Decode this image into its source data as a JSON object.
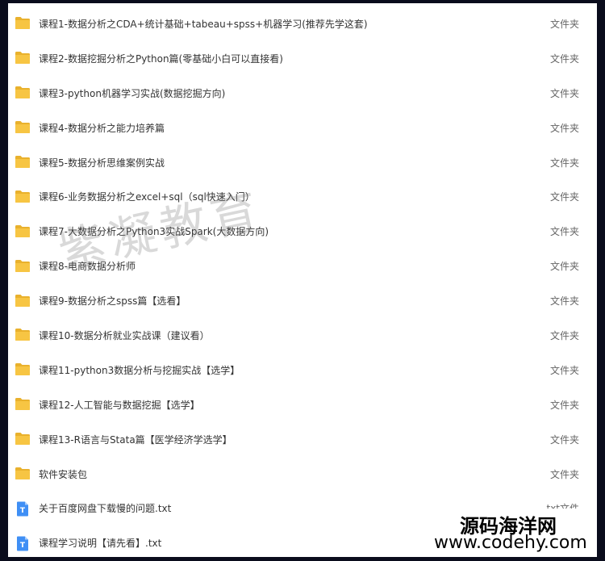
{
  "files": [
    {
      "name": "课程1-数据分析之CDA+统计基础+tabeau+spss+机器学习(推荐先学这套)",
      "type": "文件夹",
      "icon": "folder-icon"
    },
    {
      "name": "课程2-数据挖掘分析之Python篇(零基础小白可以直接看)",
      "type": "文件夹",
      "icon": "folder-icon"
    },
    {
      "name": "课程3-python机器学习实战(数据挖掘方向)",
      "type": "文件夹",
      "icon": "folder-icon"
    },
    {
      "name": "课程4-数据分析之能力培养篇",
      "type": "文件夹",
      "icon": "folder-icon"
    },
    {
      "name": "课程5-数据分析思维案例实战",
      "type": "文件夹",
      "icon": "folder-icon"
    },
    {
      "name": "课程6-业务数据分析之excel+sql（sql快速入门）",
      "type": "文件夹",
      "icon": "folder-icon"
    },
    {
      "name": "课程7-大数据分析之Python3实战Spark(大数据方向)",
      "type": "文件夹",
      "icon": "folder-icon"
    },
    {
      "name": "课程8-电商数据分析师",
      "type": "文件夹",
      "icon": "folder-icon"
    },
    {
      "name": "课程9-数据分析之spss篇【选看】",
      "type": "文件夹",
      "icon": "folder-icon"
    },
    {
      "name": "课程10-数据分析就业实战课（建议看）",
      "type": "文件夹",
      "icon": "folder-icon"
    },
    {
      "name": "课程11-python3数据分析与挖掘实战【选学】",
      "type": "文件夹",
      "icon": "folder-icon"
    },
    {
      "name": "课程12-人工智能与数据挖掘【选学】",
      "type": "文件夹",
      "icon": "folder-icon"
    },
    {
      "name": "课程13-R语言与Stata篇【医学经济学选学】",
      "type": "文件夹",
      "icon": "folder-icon"
    },
    {
      "name": "软件安装包",
      "type": "文件夹",
      "icon": "folder-icon"
    },
    {
      "name": "关于百度网盘下载慢的问题.txt",
      "type": "txt文件",
      "icon": "txt-file-icon"
    },
    {
      "name": "课程学习说明【请先看】.txt",
      "type": "",
      "icon": "txt-file-icon"
    }
  ],
  "watermark": "紫凝教育",
  "site_mark": {
    "cn": "源码海洋网",
    "en": "www.codehy.com"
  },
  "colors": {
    "folder": "#f7c543",
    "folder_dark": "#e9b12d",
    "txt": "#3f8ff5"
  }
}
